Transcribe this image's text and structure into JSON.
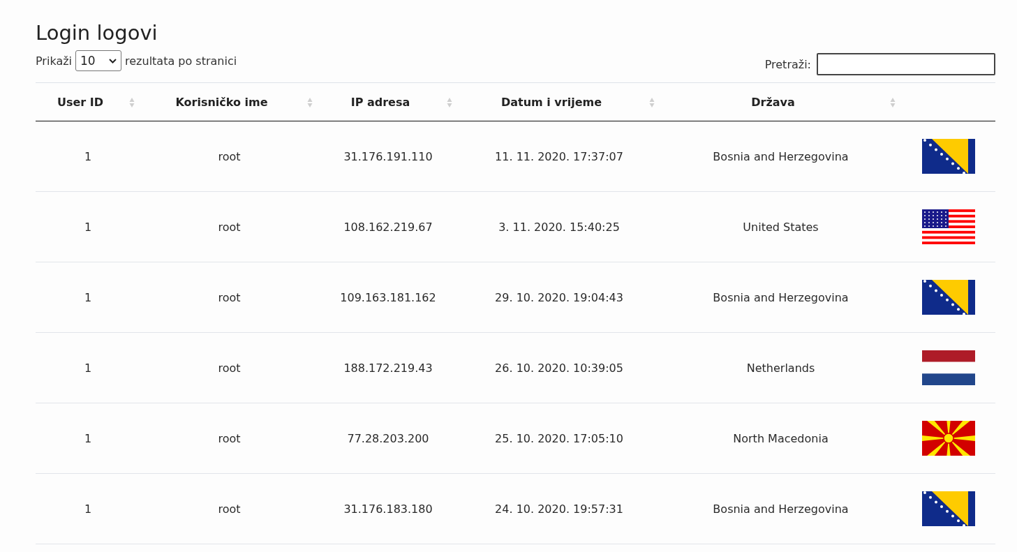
{
  "title": "Login logovi",
  "length_control": {
    "before": "Prikaži",
    "value": "10",
    "after": "rezultata po stranici"
  },
  "search": {
    "label": "Pretraži:"
  },
  "table": {
    "columns": [
      "User ID",
      "Korisničko ime",
      "IP adresa",
      "Datum i vrijeme",
      "Država"
    ],
    "rows": [
      {
        "user_id": "1",
        "username": "root",
        "ip": "31.176.191.110",
        "datetime": "11. 11. 2020. 17:37:07",
        "country": "Bosnia and Herzegovina",
        "kind": "ba"
      },
      {
        "user_id": "1",
        "username": "root",
        "ip": "108.162.219.67",
        "datetime": "3. 11. 2020. 15:40:25",
        "country": "United States",
        "kind": "us"
      },
      {
        "user_id": "1",
        "username": "root",
        "ip": "109.163.181.162",
        "datetime": "29. 10. 2020. 19:04:43",
        "country": "Bosnia and Herzegovina",
        "kind": "ba"
      },
      {
        "user_id": "1",
        "username": "root",
        "ip": "188.172.219.43",
        "datetime": "26. 10. 2020. 10:39:05",
        "country": "Netherlands",
        "kind": "nl"
      },
      {
        "user_id": "1",
        "username": "root",
        "ip": "77.28.203.200",
        "datetime": "25. 10. 2020. 17:05:10",
        "country": "North Macedonia",
        "kind": "mk"
      },
      {
        "user_id": "1",
        "username": "root",
        "ip": "31.176.183.180",
        "datetime": "24. 10. 2020. 19:57:31",
        "country": "Bosnia and Herzegovina",
        "kind": "ba"
      }
    ]
  }
}
